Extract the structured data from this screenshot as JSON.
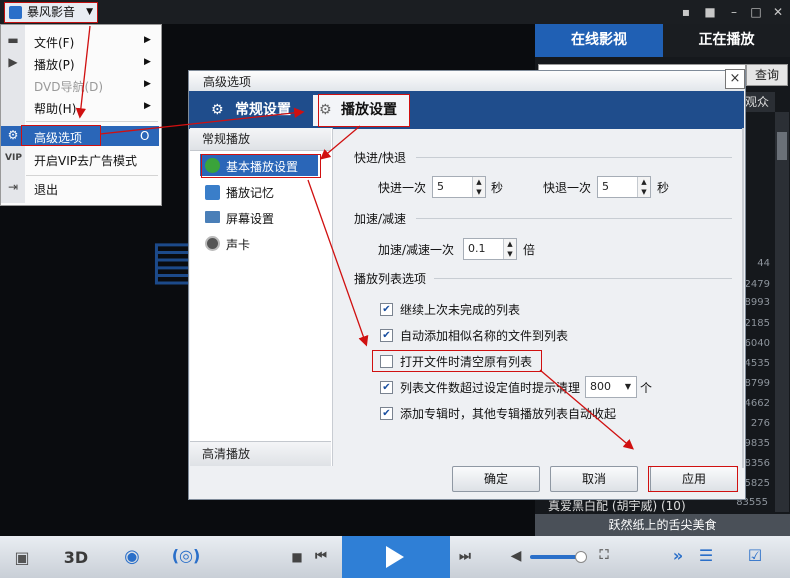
{
  "app": {
    "title": "暴风影音"
  },
  "window_controls": [
    "msg-icon",
    "skin-icon",
    "minimize-icon",
    "maximize-icon",
    "close-icon"
  ],
  "menu": {
    "items": [
      {
        "label": "文件(F)",
        "submenu": true
      },
      {
        "label": "播放(P)",
        "submenu": true
      },
      {
        "label": "DVD导航(D)",
        "submenu": true,
        "disabled": true
      },
      {
        "label": "帮助(H)",
        "submenu": true
      },
      {
        "label": "高级选项",
        "shortcut": "O",
        "highlighted": true
      },
      {
        "label": "开启VIP去广告模式",
        "icon": "VIP"
      },
      {
        "label": "退出"
      }
    ]
  },
  "right_panel": {
    "tabs": [
      "在线影视",
      "正在播放"
    ],
    "search_button": "查询",
    "header_text": "观众",
    "numbers": [
      "44",
      "2479",
      "8993",
      "2185",
      "6040",
      "4535",
      "8799",
      "4662",
      "276",
      "9835",
      "8356",
      "5825"
    ],
    "last_row": {
      "title": "真爱黑白配 (胡宇威) (10)",
      "count": "83555"
    },
    "footer": "跃然纸上的舌尖美食"
  },
  "dialog": {
    "title": "高级选项",
    "close": "×",
    "tabs": [
      "常规设置",
      "播放设置"
    ],
    "left_header": "常规播放",
    "left_items": [
      "基本播放设置",
      "播放记忆",
      "屏幕设置",
      "声卡"
    ],
    "left_footer": "高清播放",
    "sections": {
      "seek": "快进/快退",
      "speed": "加速/减速",
      "playlist": "播放列表选项"
    },
    "fields": {
      "forward_label": "快进一次",
      "forward_value": "5",
      "forward_unit": "秒",
      "backward_label": "快退一次",
      "backward_value": "5",
      "backward_unit": "秒",
      "speed_label": "加速/减速一次",
      "speed_value": "0.1",
      "speed_unit": "倍"
    },
    "options": [
      {
        "label": "继续上次未完成的列表",
        "checked": true
      },
      {
        "label": "自动添加相似名称的文件到列表",
        "checked": true
      },
      {
        "label": "打开文件时清空原有列表",
        "checked": false
      },
      {
        "label": "列表文件数超过设定值时提示清理",
        "checked": true
      },
      {
        "label": "添加专辑时，其他专辑播放列表自动收起",
        "checked": true
      }
    ],
    "cleanup_threshold": "800",
    "cleanup_unit": "个",
    "buttons": {
      "ok": "确定",
      "cancel": "取消",
      "apply": "应用"
    }
  },
  "bottom_bar": {
    "mode_3d": "3D"
  },
  "colors": {
    "accent": "#2a66b8",
    "annotation": "#d01010",
    "panel_bg": "#15181c"
  }
}
